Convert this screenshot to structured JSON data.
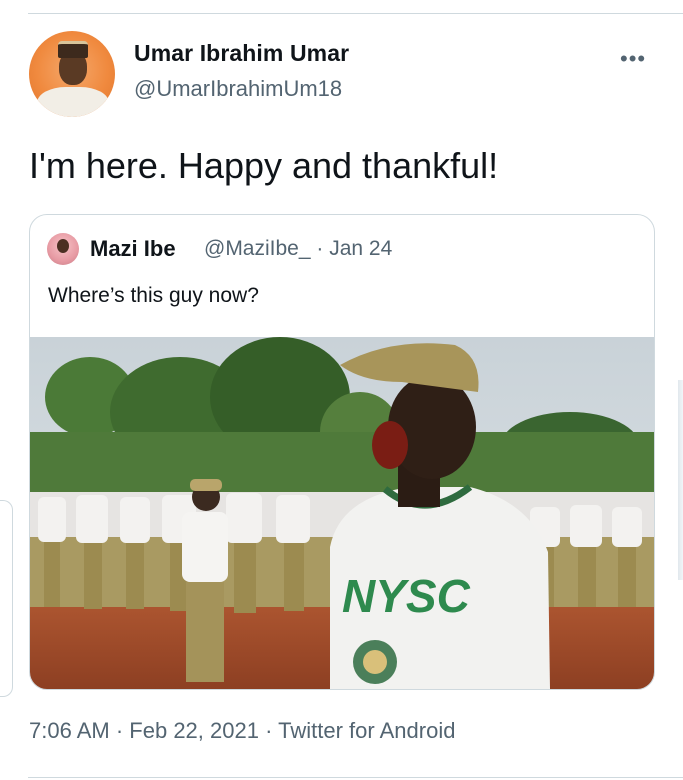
{
  "tweet": {
    "display_name": "Umar Ibrahim Umar",
    "handle": "@UmarIbrahimUm18",
    "text": "I'm here. Happy and thankful!",
    "more_icon": "more-horizontal-icon",
    "timestamp": "7:06 AM",
    "date": "Feb 22, 2021",
    "source": "Twitter for Android",
    "separator": "·"
  },
  "quoted_tweet": {
    "display_name": "Mazi Ibe",
    "handle": "@MaziIbe_",
    "date": "Jan 24",
    "text": "Where’s this guy now?",
    "image_caption_text": "NYSC"
  },
  "colors": {
    "text_primary": "#0f1419",
    "text_secondary": "#536471",
    "border": "#cfd9de"
  }
}
